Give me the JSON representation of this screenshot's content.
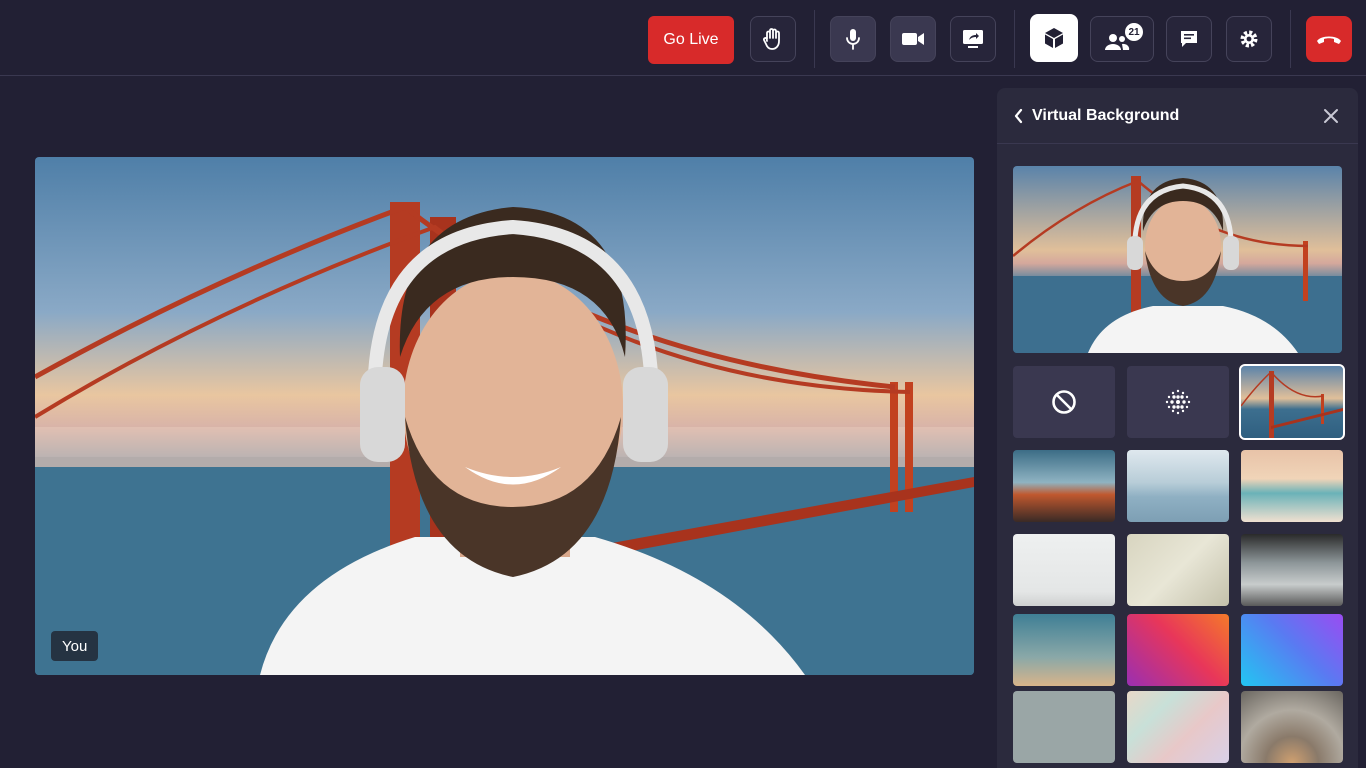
{
  "toolbar": {
    "go_live_label": "Go Live",
    "participants_count": "21",
    "icons": [
      "raise-hand-icon",
      "microphone-icon",
      "camera-icon",
      "screen-share-icon",
      "virtual-background-icon",
      "participants-icon",
      "chat-icon",
      "settings-icon",
      "end-call-icon"
    ]
  },
  "video": {
    "self_label": "You"
  },
  "panel": {
    "title": "Virtual Background",
    "options": [
      "none",
      "blur",
      "golden-gate-bridge",
      "mountains-sunset",
      "misty-mountains",
      "beach-sunset",
      "white-room",
      "plant-wall",
      "office-interior",
      "gradient-teal",
      "gradient-pink-orange",
      "gradient-cyan-purple",
      "coffee-shop-wall",
      "watercolor",
      "ornate-dome"
    ],
    "selected": "golden-gate-bridge"
  },
  "colors": {
    "background": "#222034",
    "panel": "#2b2a3d",
    "accent_red": "#d82a2a"
  }
}
